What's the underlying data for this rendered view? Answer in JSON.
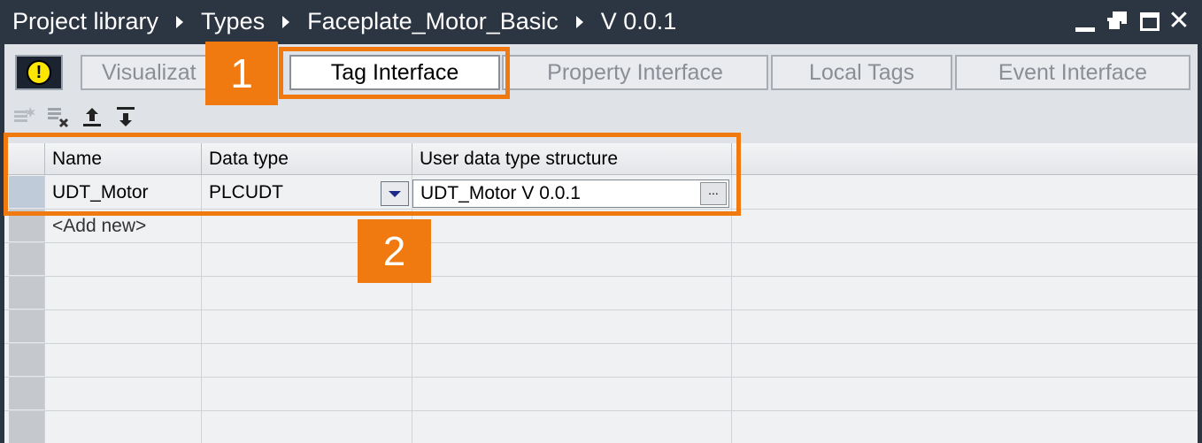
{
  "titlebar": {
    "breadcrumbs": [
      "Project library",
      "Types",
      "Faceplate_Motor_Basic",
      "V 0.0.1"
    ],
    "controls": [
      "minimize-icon",
      "restore-icon",
      "maximize-icon",
      "close-icon"
    ]
  },
  "tabs": {
    "warning_symbol": "!",
    "items": [
      {
        "label": "Visualizat"
      },
      {
        "label": "Tag Interface",
        "active": true
      },
      {
        "label": "Property Interface"
      },
      {
        "label": "Local Tags"
      },
      {
        "label": "Event Interface"
      }
    ]
  },
  "toolbar": {
    "icons": [
      "insert-row-icon",
      "delete-row-icon",
      "move-up-icon",
      "move-down-icon"
    ]
  },
  "table": {
    "columns": [
      "Name",
      "Data type",
      "User data type structure"
    ],
    "rows": [
      {
        "name": "UDT_Motor",
        "data_type": "PLCUDT",
        "structure": "UDT_Motor V 0.0.1",
        "more_label": "..."
      }
    ],
    "add_new": "<Add new>"
  },
  "callouts": {
    "one": "1",
    "two": "2"
  },
  "colors": {
    "accent": "#f07a0f",
    "titlebar": "#2c3542",
    "warning": "#ffe600"
  }
}
